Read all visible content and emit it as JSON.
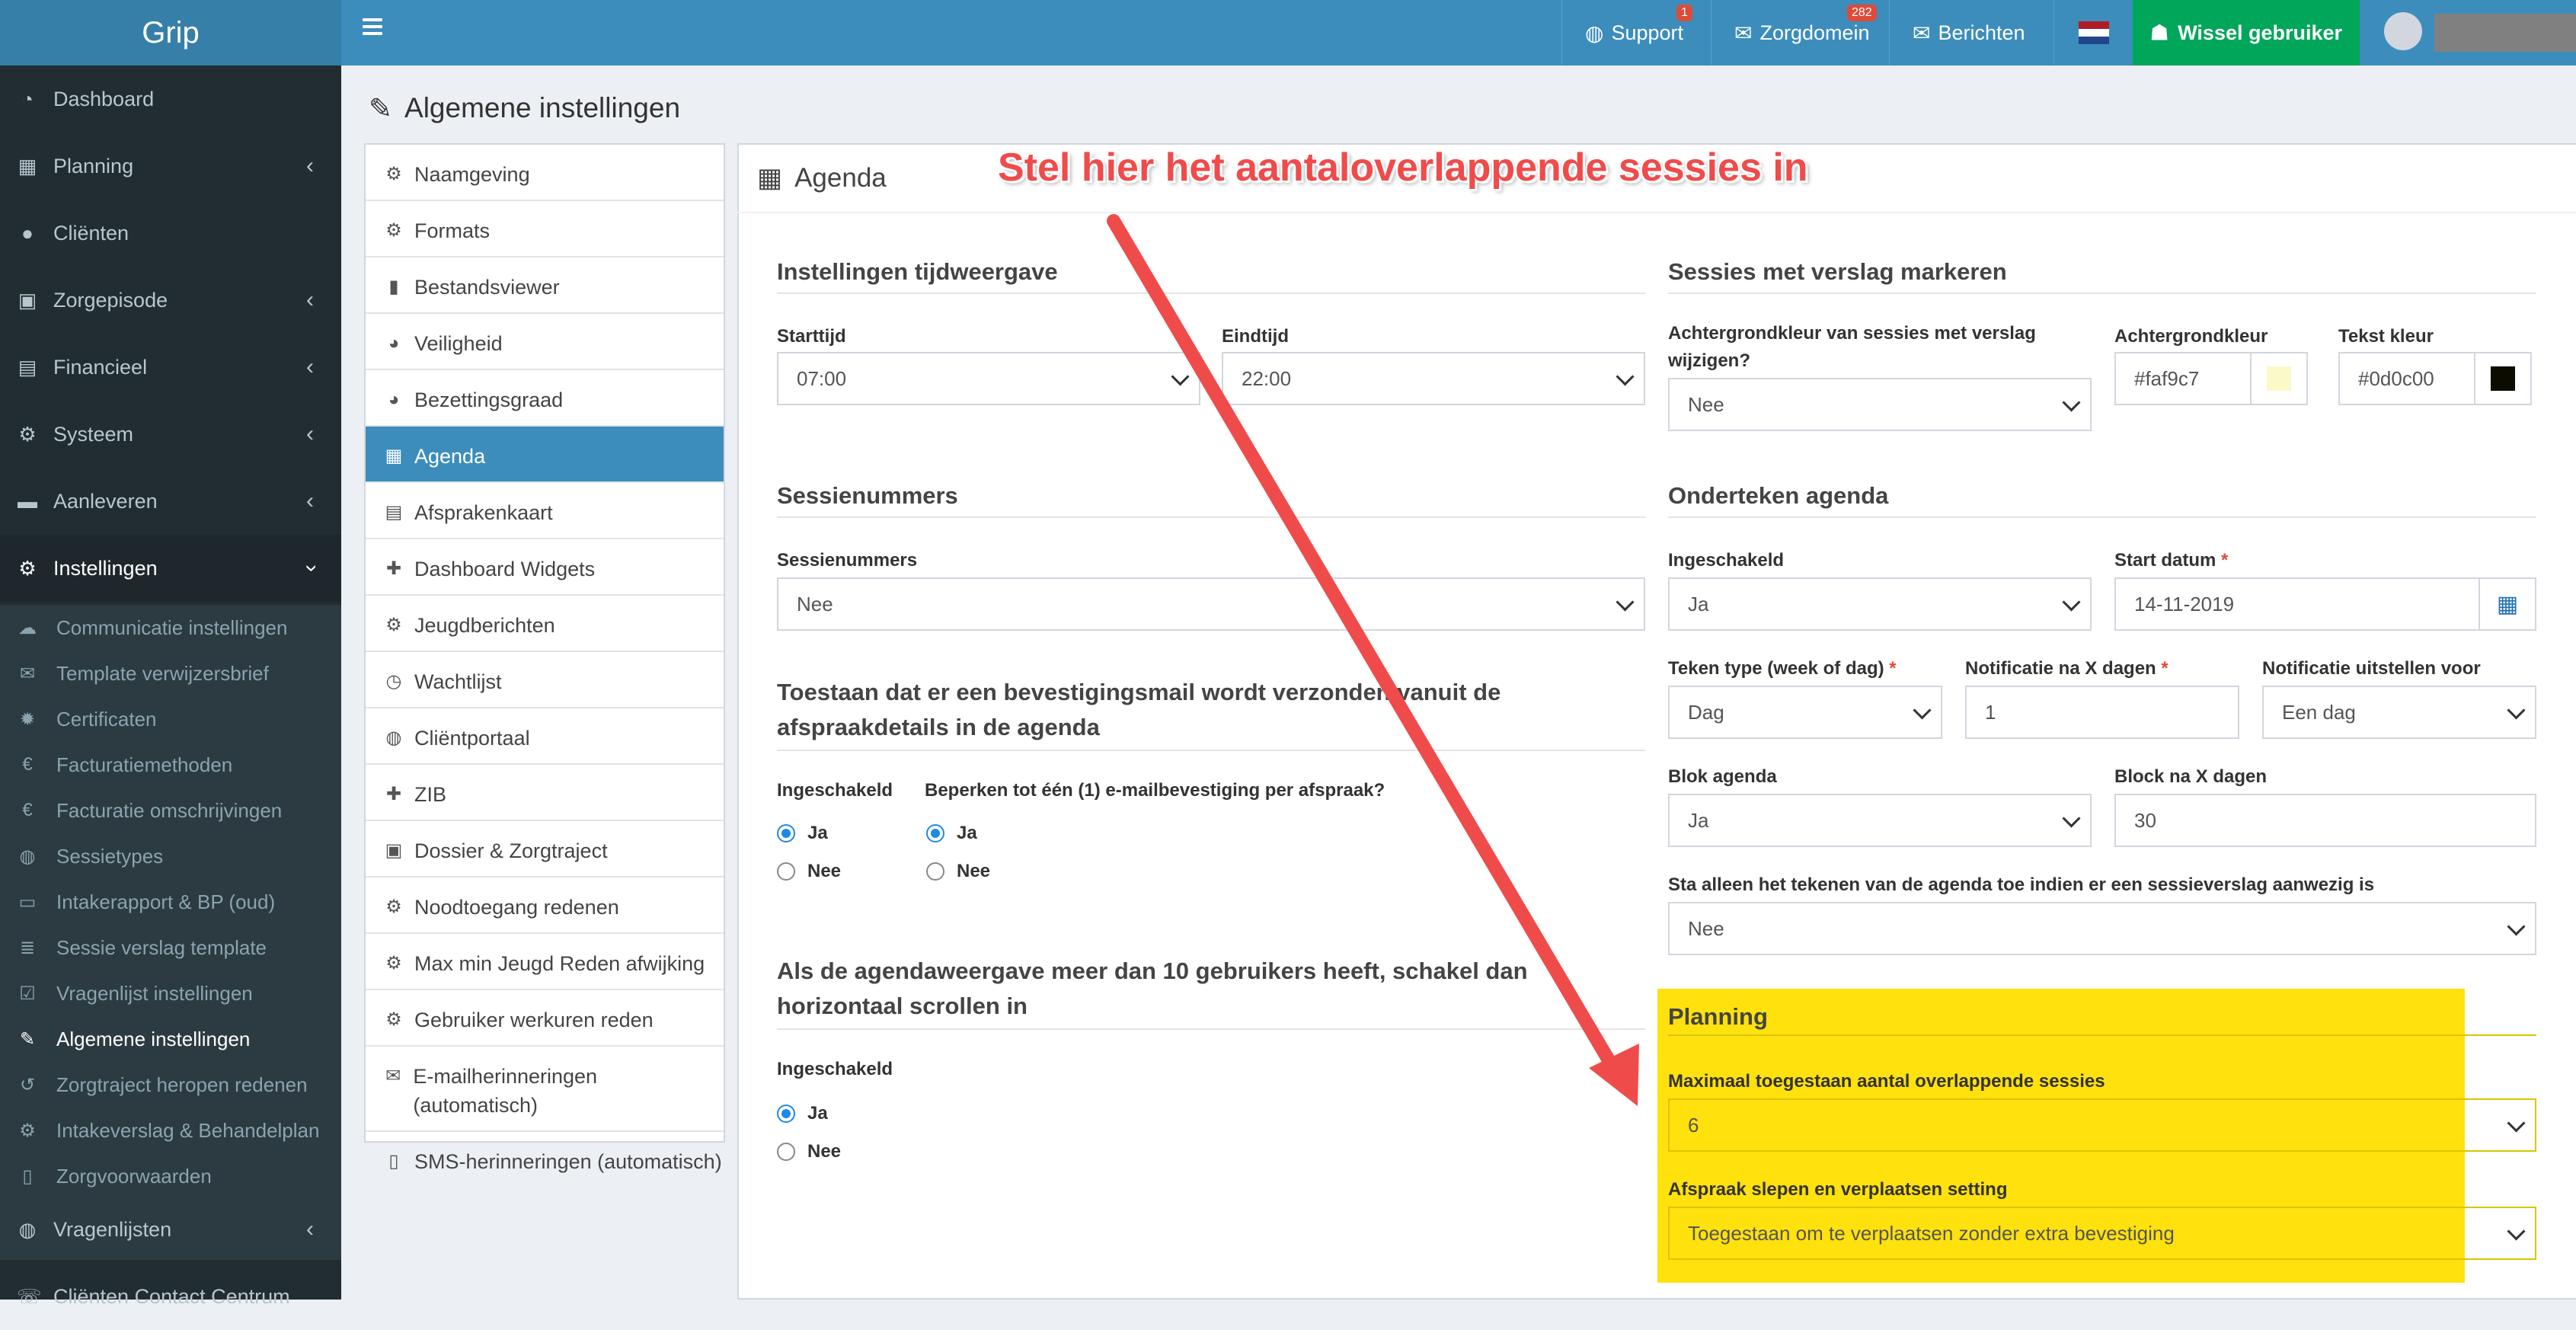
{
  "app": {
    "logo": "Grip"
  },
  "topbar": {
    "support": {
      "label": "Support",
      "badge": "1"
    },
    "zorgdomein": {
      "label": "Zorgdomein",
      "badge": "282"
    },
    "berichten": {
      "label": "Berichten"
    },
    "switch_user": "Wissel gebruiker",
    "language_flag": "nl"
  },
  "sidebar": {
    "items": [
      {
        "label": "Dashboard",
        "icon": "dashboard-icon"
      },
      {
        "label": "Planning",
        "icon": "calendar-icon"
      },
      {
        "label": "Cliënten",
        "icon": "user-icon"
      },
      {
        "label": "Zorgepisode",
        "icon": "medkit-icon"
      },
      {
        "label": "Financieel",
        "icon": "book-icon"
      },
      {
        "label": "Systeem",
        "icon": "cogs-icon"
      },
      {
        "label": "Aanleveren",
        "icon": "truck-icon"
      },
      {
        "label": "Instellingen",
        "icon": "gear-icon"
      }
    ],
    "submenu": [
      {
        "label": "Communicatie instellingen"
      },
      {
        "label": "Template verwijzersbrief"
      },
      {
        "label": "Certificaten"
      },
      {
        "label": "Facturatiemethoden"
      },
      {
        "label": "Facturatie omschrijvingen"
      },
      {
        "label": "Sessietypes"
      },
      {
        "label": "Intakerapport & BP (oud)"
      },
      {
        "label": "Sessie verslag template"
      },
      {
        "label": "Vragenlijst instellingen"
      },
      {
        "label": "Algemene instellingen"
      },
      {
        "label": "Zorgtraject heropen redenen"
      },
      {
        "label": "Intakeverslag & Behandelplan"
      },
      {
        "label": "Zorgvoorwaarden"
      }
    ],
    "bottom_items": [
      {
        "label": "Vragenlijsten"
      },
      {
        "label": "Cliënten Contact Centrum"
      }
    ]
  },
  "page": {
    "title": "Algemene instellingen"
  },
  "settings_menu": [
    "Naamgeving",
    "Formats",
    "Bestandsviewer",
    "Veiligheid",
    "Bezettingsgraad",
    "Agenda",
    "Afsprakenkaart",
    "Dashboard Widgets",
    "Jeugdberichten",
    "Wachtlijst",
    "Cliëntportaal",
    "ZIB",
    "Dossier & Zorgtraject",
    "Noodtoegang redenen",
    "Max min Jeugd Reden afwijking",
    "Gebruiker werkuren reden",
    "E-mailherinneringen (automatisch)",
    "SMS-herinneringen (automatisch)"
  ],
  "panel": {
    "title": "Agenda",
    "tijdweergave": {
      "title": "Instellingen tijdweergave",
      "start_label": "Starttijd",
      "start_value": "07:00",
      "end_label": "Eindtijd",
      "end_value": "22:00"
    },
    "sessienummers": {
      "title": "Sessienummers",
      "label": "Sessienummers",
      "value": "Nee"
    },
    "bevestigingsmail": {
      "title": "Toestaan dat er een bevestigingsmail wordt verzonden vanuit de afspraakdetails in de agenda",
      "enabled_label": "Ingeschakeld",
      "limit_label": "Beperken tot één (1) e-mailbevestiging per afspraak?",
      "yes": "Ja",
      "no": "Nee"
    },
    "scrollen": {
      "title": "Als de agendaweergave meer dan 10 gebruikers heeft, schakel dan horizontaal scrollen in",
      "enabled_label": "Ingeschakeld",
      "yes": "Ja",
      "no": "Nee"
    },
    "verslag": {
      "title": "Sessies met verslag markeren",
      "bg_change_label": "Achtergrondkleur van sessies met verslag wijzigen?",
      "bg_change_value": "Nee",
      "bg_color_label": "Achtergrondkleur",
      "bg_color_value": "#faf9c7",
      "text_color_label": "Tekst kleur",
      "text_color_value": "#0d0c00"
    },
    "onderteken": {
      "title": "Onderteken agenda",
      "enabled_label": "Ingeschakeld",
      "enabled_value": "Ja",
      "start_label": "Start datum",
      "start_value": "14-11-2019",
      "sign_type_label": "Teken type (week of dag)",
      "sign_type_value": "Dag",
      "notify_label": "Notificatie na X dagen",
      "notify_value": "1",
      "delay_label": "Notificatie uitstellen voor",
      "delay_value": "Een dag",
      "block_label": "Blok agenda",
      "block_value": "Ja",
      "block_days_label": "Block na X dagen",
      "block_days_value": "30",
      "only_report_label": "Sta alleen het tekenen van de agenda toe indien er een sessieverslag aanwezig is",
      "only_report_value": "Nee"
    },
    "planning": {
      "title": "Planning",
      "max_overlap_label": "Maximaal toegestaan aantal overlappende sessies",
      "max_overlap_value": "6",
      "drag_label": "Afspraak slepen en verplaatsen setting",
      "drag_value": "Toegestaan om te verplaatsen zonder extra bevestiging"
    }
  },
  "annotation": {
    "text": "Stel hier het aantaloverlappende sessies in"
  },
  "colors": {
    "header": "#3c8dbc",
    "sidebar": "#222d32",
    "green": "#00a65a",
    "highlight": "#ffdf00",
    "arrow": "#f04b4b"
  }
}
